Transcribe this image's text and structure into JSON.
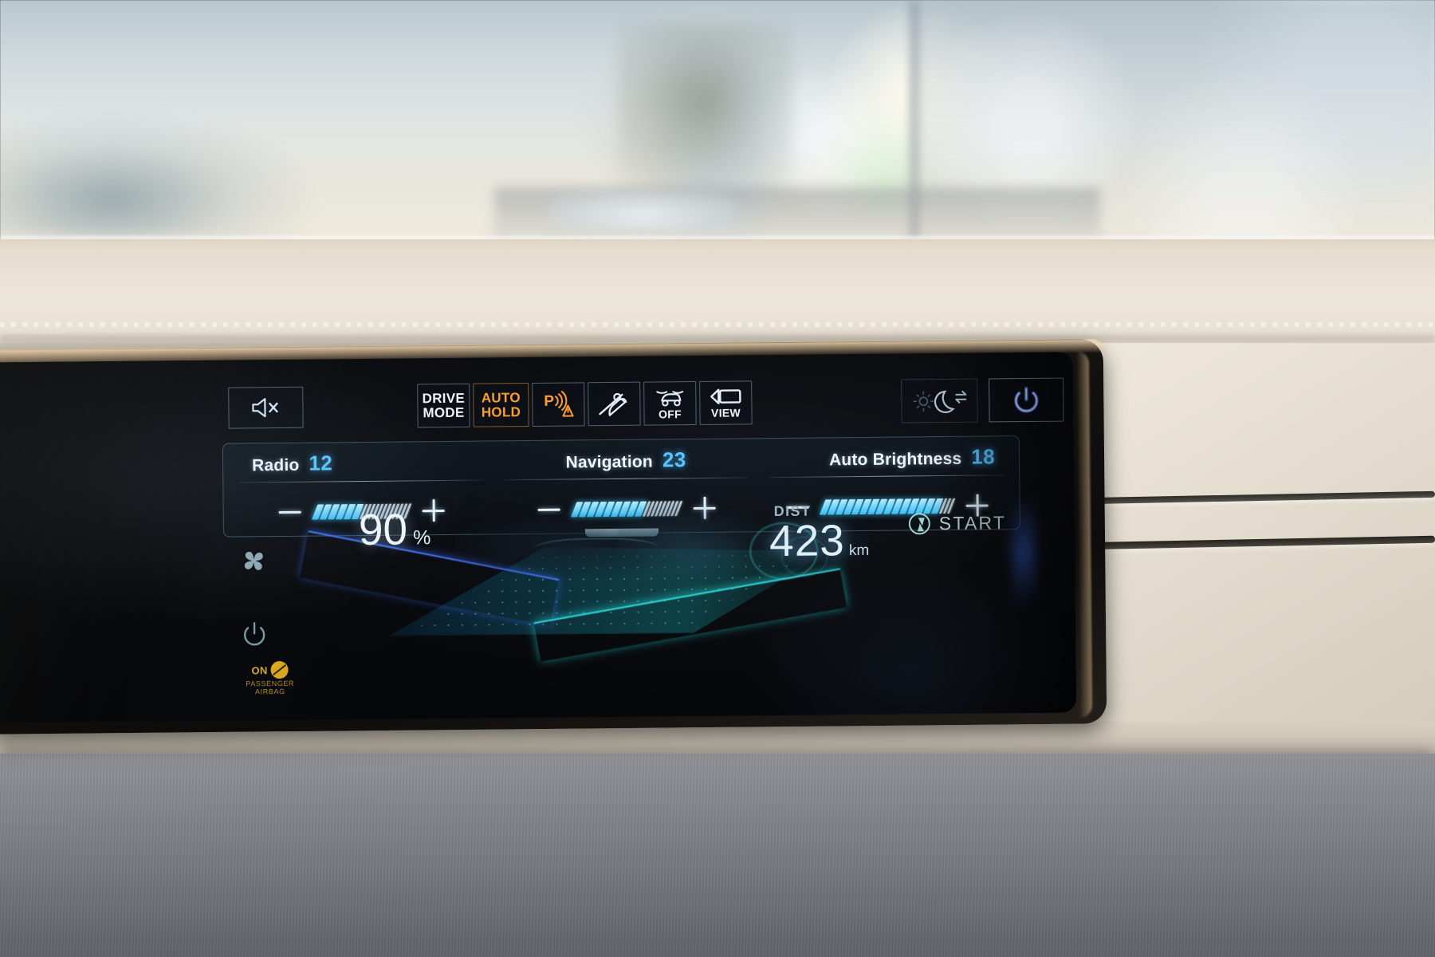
{
  "screen": {
    "toolbar": {
      "mute_icon": "speaker-mute-icon",
      "buttons": [
        {
          "id": "drive-mode",
          "line1": "DRIVE",
          "line2": "MODE",
          "state": "inactive"
        },
        {
          "id": "auto-hold",
          "line1": "AUTO",
          "line2": "HOLD",
          "state": "active",
          "color": "#ffa02a"
        },
        {
          "id": "parking-distance-warning",
          "icon": "parking-sensor-icon",
          "state": "active",
          "color": "#ffa02a"
        },
        {
          "id": "hill-descent-control",
          "icon": "hill-descent-icon",
          "state": "inactive"
        },
        {
          "id": "traction-control",
          "icon": "esc-skid-icon",
          "sublabel": "OFF",
          "state": "inactive"
        },
        {
          "id": "camera-view",
          "icon": "camera-icon",
          "sublabel": "VIEW",
          "state": "inactive"
        }
      ],
      "day_night": {
        "id": "day-night-toggle",
        "icon": "moon-swap-icon"
      },
      "power": {
        "id": "power-button",
        "icon": "power-icon",
        "color": "#4b6cff"
      }
    },
    "sliders": [
      {
        "id": "radio",
        "label": "Radio",
        "value": "12",
        "filled": 6,
        "total": 18
      },
      {
        "id": "navigation",
        "label": "Navigation",
        "value": "23",
        "filled": 9,
        "total": 18
      },
      {
        "id": "auto-brightness",
        "label": "Auto Brightness",
        "value": "18",
        "filled": 15,
        "total": 18
      }
    ],
    "slider_controls": {
      "minus": "minus-button",
      "plus": "plus-button"
    },
    "battery": {
      "percent": "90",
      "percent_symbol": "%"
    },
    "range": {
      "label": "DIST",
      "value": "423",
      "unit": "km"
    },
    "charge": {
      "label": "START",
      "icon": "charge-bolt-icon"
    },
    "rail": [
      {
        "id": "climate-fan",
        "icon": "fan-icon"
      },
      {
        "id": "climate-power",
        "icon": "power-icon"
      }
    ],
    "airbag": {
      "status": "ON",
      "line1": "PASSENGER",
      "line2": "AIRBAG",
      "color": "#d8a61e"
    }
  },
  "colors": {
    "accent_cyan": "#36c0f5",
    "value_blue": "#59c4ff",
    "amber": "#ffa02a",
    "power_blue": "#4b6cff",
    "airbag_amber": "#d8a61e"
  }
}
